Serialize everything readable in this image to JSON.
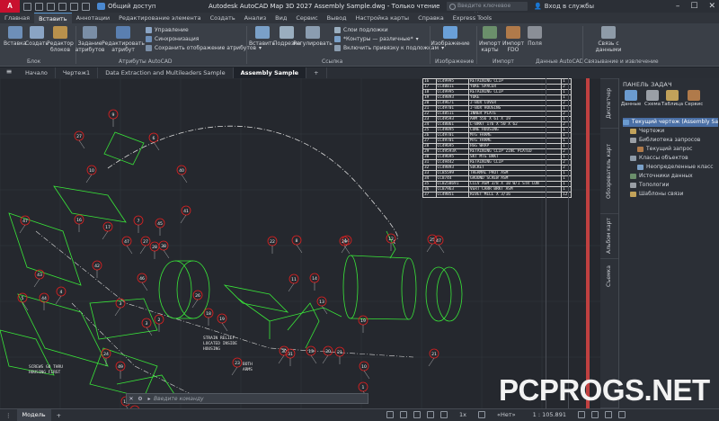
{
  "titlebar": {
    "logo": "A",
    "share": "Общий доступ",
    "title": "Autodesk AutoCAD Map 3D 2027   Assembly Sample.dwg - Только чтение",
    "search_placeholder": "Введите ключевое слово/фразу",
    "signin": "Вход в службы"
  },
  "menu": [
    "Главная",
    "Вставить",
    "Аннотации",
    "Редактирование элемента",
    "Создать",
    "Анализ",
    "Вид",
    "Сервис",
    "Вывод",
    "Настройка карты",
    "Справка",
    "Express Tools"
  ],
  "menu_active": "Вставить",
  "ribbon": {
    "blok_buttons": [
      "Вставка",
      "Создать",
      "Редактор блоков"
    ],
    "attr_buttons": [
      "Задание атрибутов",
      "Редактировать атрибут"
    ],
    "attr_small": [
      "Управление",
      "Синхронизация",
      "Сохранить отображение атрибутов"
    ],
    "ref_buttons": [
      "Вставить",
      "Подрезка",
      "Регулировать"
    ],
    "ref_small": [
      "Слои подложки",
      "*Контуры — различные*",
      "Включить привязку к подложкам"
    ],
    "img_button": "Изображение",
    "import_buttons": [
      "Импорт карты",
      "Импорт FDO",
      "Поля"
    ],
    "link_button": "Связь с данными",
    "groups": [
      "Блок",
      "Атрибуты AutoCAD",
      "Ссылка",
      "Изображение",
      "Импорт",
      "Данные AutoCAD",
      "Связывание и извлечение"
    ]
  },
  "doctabs": [
    "Начало",
    "Чертеж1",
    "Data Extraction and Multileaders Sample",
    "Assembly Sample"
  ],
  "doctab_active": "Assembly Sample",
  "bom": [
    [
      "16",
      "CC49995",
      "RETAINING CLIP",
      "1"
    ],
    [
      "17",
      "CC40011",
      "YOKE SPACER",
      "2"
    ],
    [
      "18",
      "CC49995",
      "RETAINING CLIP",
      "1"
    ],
    [
      "19",
      "CC49893",
      "YOKE",
      "1"
    ],
    [
      "20",
      "CC49671",
      "J-BOX COVER",
      "2"
    ],
    [
      "21",
      "CC49701",
      "J-BOX HOUSING",
      "1"
    ],
    [
      "22",
      "CC48511",
      "INNER PLATE",
      "2"
    ],
    [
      "23",
      "CC49593",
      "ARM 556 X 61 X 19",
      "1"
    ],
    [
      "24",
      "CC48061",
      "L-BRKT 176 X 50 X 62",
      "2"
    ],
    [
      "25",
      "CC49895",
      "CONE HOUSING",
      "1"
    ],
    [
      "26",
      "CC49701",
      "MTG FRAME",
      "1"
    ],
    [
      "27",
      "CC49701",
      "MTG FRAME",
      "1"
    ],
    [
      "28",
      "CC49695",
      "HSG WRAP",
      "1"
    ],
    [
      "29",
      "CC49593A",
      "RETAINING CLIP ZINC PLATED",
      "2"
    ],
    [
      "30",
      "CC49695",
      "SKT MTG BRKT",
      "1"
    ],
    [
      "31",
      "CC49442",
      "RETAINING CLIP",
      "2"
    ],
    [
      "32",
      "CC49893",
      "SOCKET",
      "2"
    ],
    [
      "33",
      "CC85599",
      "THERMAL PROT ASM",
      "1"
    ],
    [
      "34",
      "CC8744",
      "GROUND SCREW ASM",
      "1"
    ],
    [
      "35",
      "CC8258691",
      "CCLV ASM 3/8 X 10 W/1 STR CON",
      "1"
    ],
    [
      "36",
      "CC87963",
      "VERT CARR BRKT ASM",
      "1"
    ],
    [
      "37",
      "CC49851",
      "RIVET MILL X 3/16",
      "12"
    ]
  ],
  "vtabs": [
    "Диспетчер",
    "Обозреватель карт",
    "Альбом карт",
    "Съемка"
  ],
  "taskpane": {
    "title": "ПАНЕЛЬ ЗАДАЧ",
    "buttons": [
      "Данные",
      "Схема",
      "Таблица",
      "Сервис"
    ],
    "tree": [
      {
        "label": "Текущий чертеж (Assembly Sa",
        "depth": 0,
        "selected": true
      },
      {
        "label": "Чертежи",
        "depth": 1
      },
      {
        "label": "Библиотека запросов",
        "depth": 1
      },
      {
        "label": "Текущий запрос",
        "depth": 2
      },
      {
        "label": "Классы объектов",
        "depth": 1
      },
      {
        "label": "Неопределенные класс",
        "depth": 2
      },
      {
        "label": "Источники данных",
        "depth": 1
      },
      {
        "label": "Топологии",
        "depth": 1
      },
      {
        "label": "Шаблоны связи",
        "depth": 1
      }
    ]
  },
  "command_placeholder": "Введите команду",
  "callouts": [
    "47",
    "9",
    "27",
    "10",
    "16",
    "6",
    "17",
    "7",
    "40",
    "41",
    "45",
    "38",
    "43",
    "44",
    "5",
    "4",
    "42",
    "47",
    "27",
    "28",
    "46",
    "3",
    "2",
    "3",
    "26",
    "18",
    "19",
    "23",
    "22",
    "8",
    "11",
    "14",
    "13",
    "14",
    "19",
    "10",
    "30",
    "31",
    "13",
    "20",
    "21",
    "1",
    "21",
    "12",
    "29",
    "25",
    "24",
    "12",
    "15",
    "49",
    "47"
  ],
  "annotations": {
    "strain": "STRAIN RELIEF LOCATED INSIDE HOUSING",
    "screws": "SCREWS GO THRU HOUSING FIRST",
    "both": "BOTH ARMS"
  },
  "statusbar": {
    "model": "Модель",
    "scale_label": "1x",
    "nag": "«Нет»",
    "scale": "1 : 105.891"
  },
  "watermark": "PCPROGS.NET",
  "colors": {
    "accent": "#5b9bd5",
    "brand": "#c8102e",
    "drawing": "#39e639",
    "callout": "#e02020"
  }
}
